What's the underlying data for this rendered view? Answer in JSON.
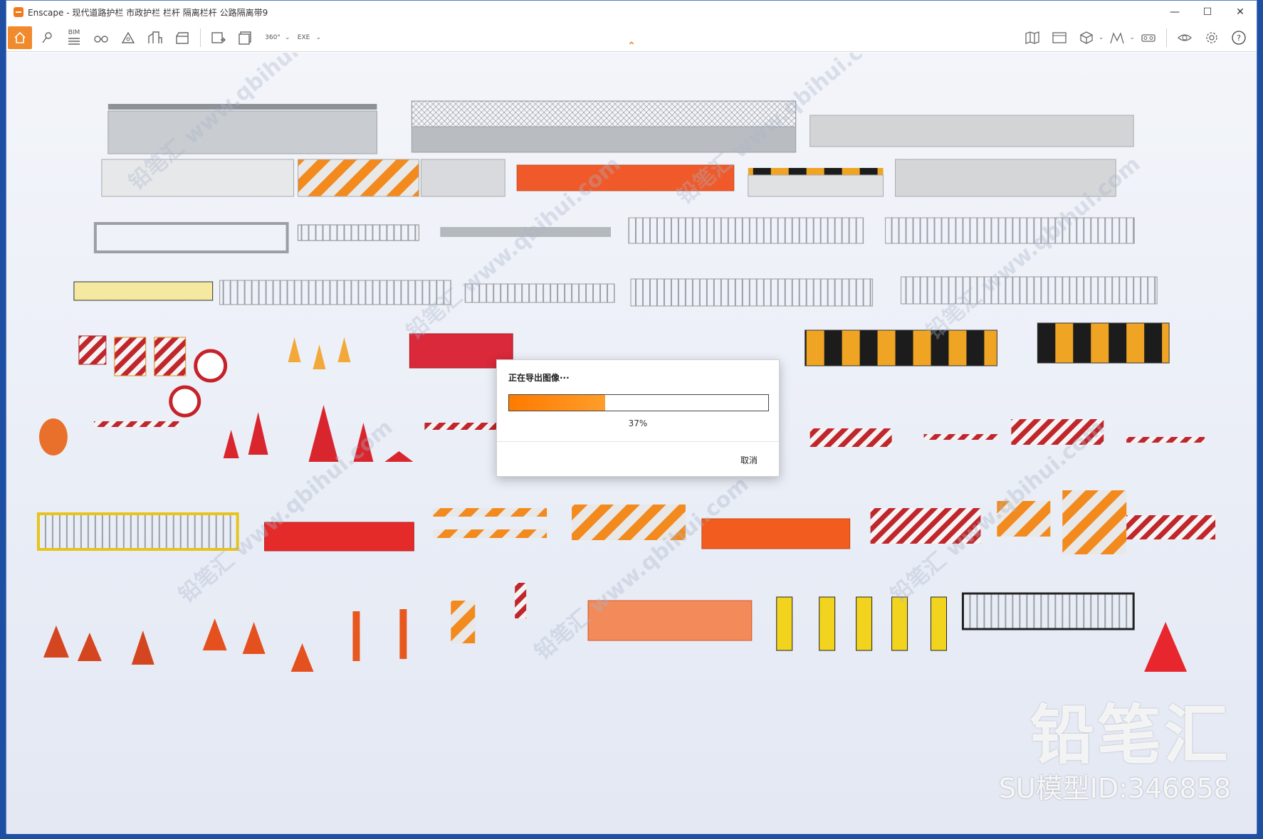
{
  "window": {
    "title": "Enscape - 现代道路护栏 市政护栏 栏杆 隔离栏杆 公路隔离带9",
    "controls": {
      "minimize": "—",
      "maximize": "☐",
      "close": "✕"
    }
  },
  "toolbar": {
    "bim_label": "BIM",
    "pano_label": "360°",
    "exe_label": "EXE",
    "help_label": "?"
  },
  "dialog": {
    "title": "正在导出图像···",
    "progress": 37,
    "progress_text": "37%",
    "cancel_label": "取消"
  },
  "overlay": {
    "brand": "铅笔汇",
    "model_id": "SU模型ID:346858",
    "watermark_text": "铅笔汇 www.qbihui.com"
  },
  "colors": {
    "accent": "#f07b1d",
    "progress": "#ff7a00"
  }
}
